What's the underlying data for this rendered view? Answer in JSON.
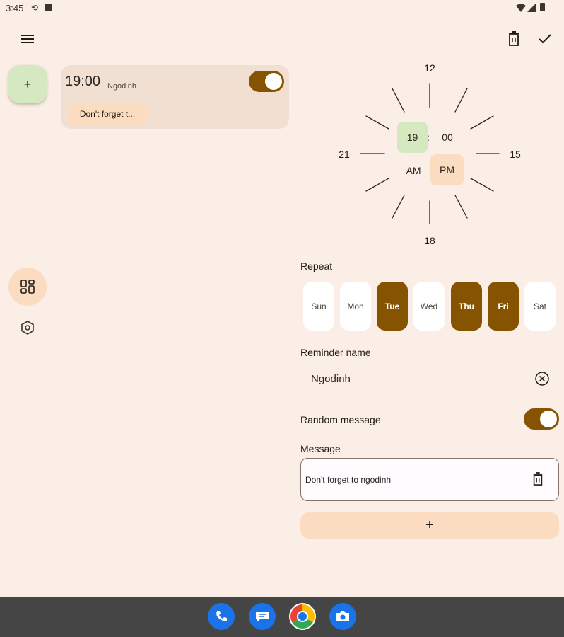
{
  "status_bar": {
    "time": "3:45"
  },
  "card": {
    "time": "19:00",
    "name": "Ngodinh",
    "message_chip": "Don't forget t..."
  },
  "fab": {
    "label": "+"
  },
  "clock": {
    "numbers": {
      "top": "12",
      "right": "15",
      "bottom": "18",
      "left": "21"
    },
    "hour": "19",
    "separator": ":",
    "minute": "00",
    "am": "AM",
    "pm": "PM"
  },
  "repeat": {
    "label": "Repeat",
    "days": [
      {
        "label": "Sun",
        "selected": false
      },
      {
        "label": "Mon",
        "selected": false
      },
      {
        "label": "Tue",
        "selected": true
      },
      {
        "label": "Wed",
        "selected": false
      },
      {
        "label": "Thu",
        "selected": true
      },
      {
        "label": "Fri",
        "selected": true
      },
      {
        "label": "Sat",
        "selected": false
      }
    ]
  },
  "reminder_name": {
    "label": "Reminder name",
    "value": "Ngodinh"
  },
  "random_message": {
    "label": "Random message"
  },
  "message": {
    "label": "Message",
    "value": "Don't forget to ngodinh"
  },
  "add_message": {
    "label": "+"
  },
  "colors": {
    "accent": "#865300",
    "background": "#fbeee6",
    "green_container": "#d6e8bf",
    "peach_container": "#fcdcc0"
  }
}
